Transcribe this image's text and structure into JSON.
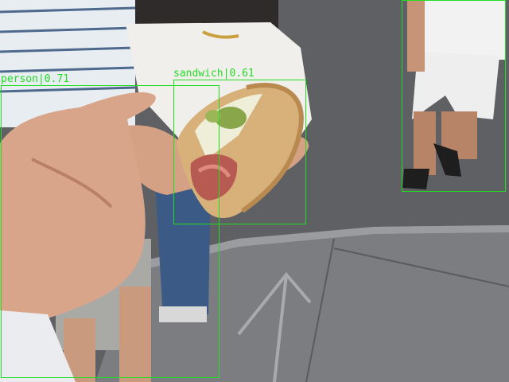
{
  "scene": {
    "kind": "photo",
    "description_colors": {
      "pavement": "#6e6f72",
      "curb": "#8a8c8f",
      "skin": "#d9a58a",
      "bread": "#d8b07a",
      "paper": "#f1efec",
      "box_color": "#22dd22"
    }
  },
  "detections": [
    {
      "label": "person",
      "score": "0.71",
      "text": "person|0.71"
    },
    {
      "label": "sandwich",
      "score": "0.61",
      "text": "sandwich|0.61"
    },
    {
      "label": "person",
      "score": "",
      "text": ""
    }
  ]
}
